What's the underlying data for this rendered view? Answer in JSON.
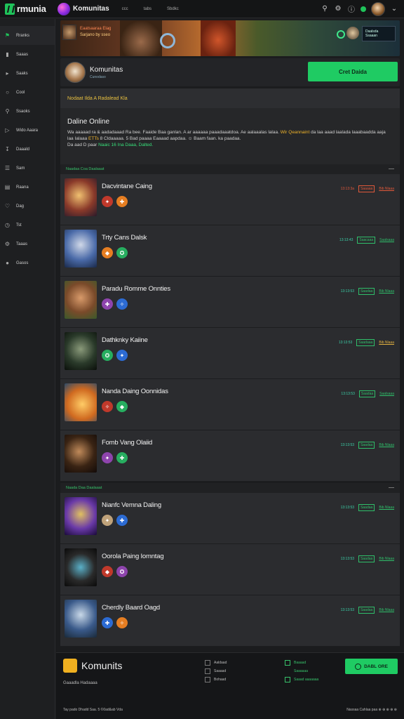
{
  "topbar": {
    "logo_text": "rmunia",
    "brand_name": "Komunitas",
    "nav": [
      "ccc",
      "tabs",
      "Sbdkc"
    ],
    "icons": [
      "search-icon",
      "settings-icon",
      "notification-dot",
      "chevron-down-icon"
    ]
  },
  "sidebar": {
    "items": [
      {
        "label": "Rranks",
        "icon": "flag-icon"
      },
      {
        "label": "Saaas",
        "icon": "bookmark-icon"
      },
      {
        "label": "Saaks",
        "icon": "tag-icon"
      },
      {
        "label": "Cool",
        "icon": "circle-icon"
      },
      {
        "label": "Ssaoks",
        "icon": "search-icon"
      },
      {
        "label": "Wido Aaara",
        "icon": "video-icon"
      },
      {
        "label": "Daaald",
        "icon": "download-icon"
      },
      {
        "label": "Sam",
        "icon": "list-icon"
      },
      {
        "label": "Raana",
        "icon": "chart-icon"
      },
      {
        "label": "Dag",
        "icon": "heart-icon"
      },
      {
        "label": "Tst",
        "icon": "clock-icon"
      },
      {
        "label": "Taaas",
        "icon": "gear-icon"
      },
      {
        "label": "Gasos",
        "icon": "dot-icon"
      }
    ]
  },
  "banner": {
    "title": "Eaatsaaraa Elag",
    "subtitle": "Sarjano by sseo",
    "box_line1": "Daalsda",
    "box_line2": "Ssaaan"
  },
  "header": {
    "title": "Komunitas",
    "subtitle": "Cunodaso",
    "cta_label": "Cret Daida"
  },
  "notice": {
    "bar_text": "Nodaat Ilda A Radalead Kla",
    "title": "Daline Online",
    "body_line1": "Wa aaaaad ra & aadadaaad Ra bee. Faaide Baa ganlan. A ar aaaaaa paaadaaatdoa. Ae aalaaalas lalaa.",
    "body_highlight1": "Wir Qeannaint",
    "body_line2": "da laa aaad laalada laaabaadda aaja laa Ialaaa",
    "body_highlight2": "ETTs",
    "body_line3": "8 Cldaaaaa. 5 Bad paaaa Eaaaad aapdaa. ☺ Baam faan. ka paadaa.",
    "body_line4": "Da aad D paar",
    "body_highlight3": "Naaic",
    "body_highlight4": "16 Ina Daaa, Dalted."
  },
  "list1": {
    "header": "Naadaa  Coa  Daalaaat",
    "rows": [
      {
        "title": "Dacvintane Caing",
        "num": "13:13:3a",
        "tag": "Saaaaa",
        "link": "Bib Nlaaa",
        "style": "hot",
        "b1": "#c0392b",
        "b2": "#e67e22"
      },
      {
        "title": "Trty Cans Dalsk",
        "num": "13:13:43",
        "tag": "Saacaaa",
        "link": "Saalsaaa",
        "style": "",
        "b1": "#e67e22",
        "b2": "#27ae60"
      },
      {
        "title": "Paradu Romme Onnties",
        "num": "13:13:53",
        "tag": "Saadaa",
        "link": "Bib Nlaaa",
        "style": "",
        "b1": "#8e44ad",
        "b2": "#2c6bd3"
      },
      {
        "title": "Dathknky Kaiine",
        "num": "13:13:53",
        "tag": "Saadaaa",
        "link": "Bib Nlaaa",
        "style": "warm",
        "b1": "#27ae60",
        "b2": "#2c6bd3"
      },
      {
        "title": "Nanda Daing Oonnidas",
        "num": "13:13:53",
        "tag": "Saadaa",
        "link": "Saalsaaa",
        "style": "",
        "b1": "#c0392b",
        "b2": "#27ae60"
      },
      {
        "title": "Fomb Vang Olaiid",
        "num": "13:13:53",
        "tag": "Saadaa",
        "link": "Bib Nlaaa",
        "style": "",
        "b1": "#8e44ad",
        "b2": "#27ae60"
      }
    ]
  },
  "list2": {
    "header": "Naada  Daa  Daalaaat",
    "rows": [
      {
        "title": "Nianfc Vemna Daling",
        "num": "13:13:53",
        "tag": "Saadaa",
        "link": "Bib Nlaaa",
        "style": "",
        "b1": "#bfa27a",
        "b2": "#2c6bd3"
      },
      {
        "title": "Oorola Paing Iomntag",
        "num": "13:13:53",
        "tag": "Saadaa",
        "link": "Bib Nlaaa",
        "style": "",
        "b1": "#c0392b",
        "b2": "#8e44ad"
      },
      {
        "title": "Cherdly Baard Oagd",
        "num": "13:13:53",
        "tag": "Saadaa",
        "link": "Bib Nlaaa",
        "style": "",
        "b1": "#2c6bd3",
        "b2": "#e67e22"
      }
    ]
  },
  "footer": {
    "logo_text": "Komunits",
    "tagline": "Gaaadla Hadaaaa",
    "links": [
      "Aaldaad",
      "Saaaad",
      "Bohaad",
      "Saaaaa"
    ],
    "links2": [
      "Baaaad",
      "Saaaaaa",
      "Saaad aaaaaaa"
    ],
    "cta_label": "DABL ORE",
    "bottom_left": "Ta‌y pado Dhadd Saa.  5 ©0ad&ab Vda",
    "bottom_right": "Nassaa Cahlaa paa  ⊕ ⊕ ⊕ ⊕ ⊕"
  },
  "colors": {
    "accent": "#1fcb63",
    "background": "#1b1c1e",
    "panel": "#2b2c2f",
    "warning": "#e8c040"
  }
}
